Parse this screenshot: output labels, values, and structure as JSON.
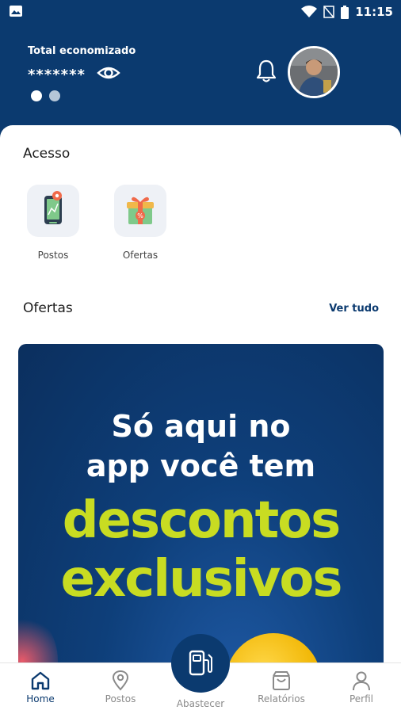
{
  "status_bar": {
    "time": "11:15"
  },
  "header": {
    "total_label": "Total economizado",
    "total_value": "*******",
    "brand_color": "#0b3a6f"
  },
  "access": {
    "title": "Acesso",
    "items": [
      {
        "label": "Postos",
        "icon": "phone-map-icon"
      },
      {
        "label": "Ofertas",
        "icon": "gift-icon"
      }
    ]
  },
  "offers": {
    "title": "Ofertas",
    "see_all": "Ver tudo",
    "banner": {
      "line1": "Só aqui no",
      "line2": "app você tem",
      "line3": "descontos",
      "line4": "exclusivos",
      "accent_color": "#c8dc22"
    }
  },
  "bottom_nav": {
    "items": [
      {
        "label": "Home",
        "icon": "home-icon",
        "active": true
      },
      {
        "label": "Postos",
        "icon": "location-pin-icon",
        "active": false
      },
      {
        "label": "Abastecer",
        "icon": "fuel-pump-icon",
        "active": false
      },
      {
        "label": "Relatórios",
        "icon": "shopping-bag-icon",
        "active": false
      },
      {
        "label": "Perfil",
        "icon": "person-icon",
        "active": false
      }
    ]
  }
}
